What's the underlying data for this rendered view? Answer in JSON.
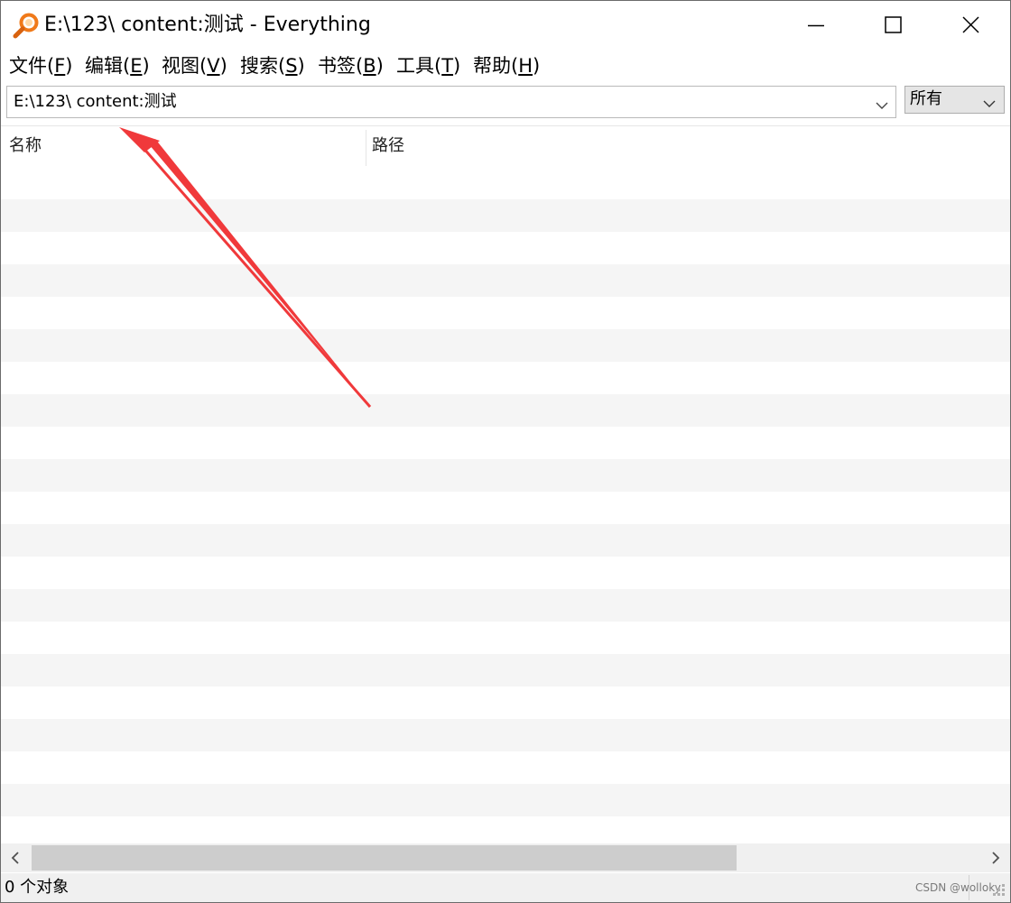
{
  "window": {
    "title": "E:\\123\\ content:测试  - Everything",
    "app_icon": "magnifier-icon"
  },
  "title_buttons": {
    "minimize_icon": "minimize-icon",
    "maximize_icon": "maximize-icon",
    "close_icon": "close-icon"
  },
  "menu": {
    "items": [
      {
        "label": "文件(",
        "key": "F",
        "suffix": ")"
      },
      {
        "label": "编辑(",
        "key": "E",
        "suffix": ")"
      },
      {
        "label": "视图(",
        "key": "V",
        "suffix": ")"
      },
      {
        "label": "搜索(",
        "key": "S",
        "suffix": ")"
      },
      {
        "label": "书签(",
        "key": "B",
        "suffix": ")"
      },
      {
        "label": "工具(",
        "key": "T",
        "suffix": ")"
      },
      {
        "label": "帮助(",
        "key": "H",
        "suffix": ")"
      }
    ]
  },
  "search": {
    "value": "E:\\123\\ content:测试",
    "dropdown_icon": "chevron-down-icon"
  },
  "filter": {
    "selected": "所有",
    "dropdown_icon": "chevron-down-icon"
  },
  "columns": {
    "name": "名称",
    "path": "路径"
  },
  "results": {
    "rows": []
  },
  "scrollbar": {
    "left_icon": "scroll-left-arrow-icon",
    "right_icon": "scroll-right-arrow-icon"
  },
  "status": {
    "text": "0 个对象"
  },
  "watermark": {
    "text": "CSDN @wolloky"
  },
  "colors": {
    "annotation_arrow": "#f0393b",
    "icon_orange": "#f07a1a",
    "row_stripe": "#f5f5f5",
    "chrome_bg": "#f0f0f0"
  }
}
